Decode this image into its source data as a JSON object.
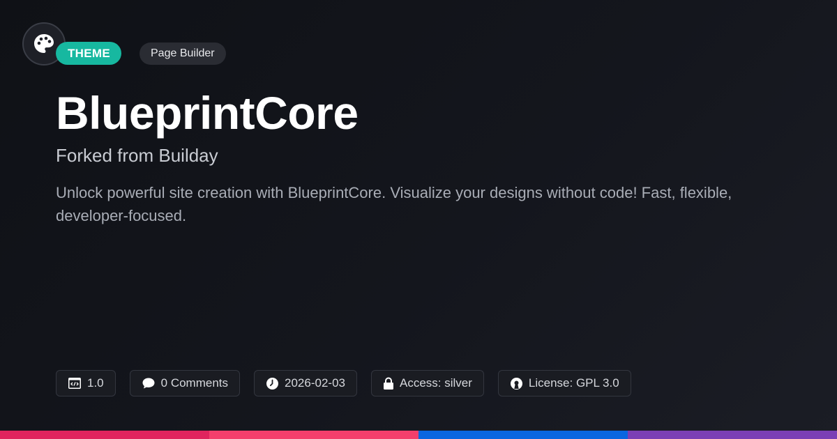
{
  "header": {
    "badge_type": "THEME",
    "badge_category": "Page Builder"
  },
  "title": "BlueprintCore",
  "subtitle": "Forked from Builday",
  "description": "Unlock powerful site creation with BlueprintCore. Visualize your designs without code! Fast, flexible, developer-focused.",
  "meta": {
    "version": "1.0",
    "comments": "0 Comments",
    "date": "2026-02-03",
    "access": "Access: silver",
    "license": "License: GPL 3.0"
  },
  "icons": {
    "logo": "palette-icon",
    "version": "code-window-icon",
    "comments": "chat-bubble-icon",
    "date": "clock-icon",
    "access": "lock-icon",
    "license": "open-source-icon"
  },
  "colors": {
    "theme_badge": "#17b8a0",
    "stripe": [
      "#e0245e",
      "#f43f6c",
      "#0a66e0",
      "#7b3fb5"
    ]
  }
}
